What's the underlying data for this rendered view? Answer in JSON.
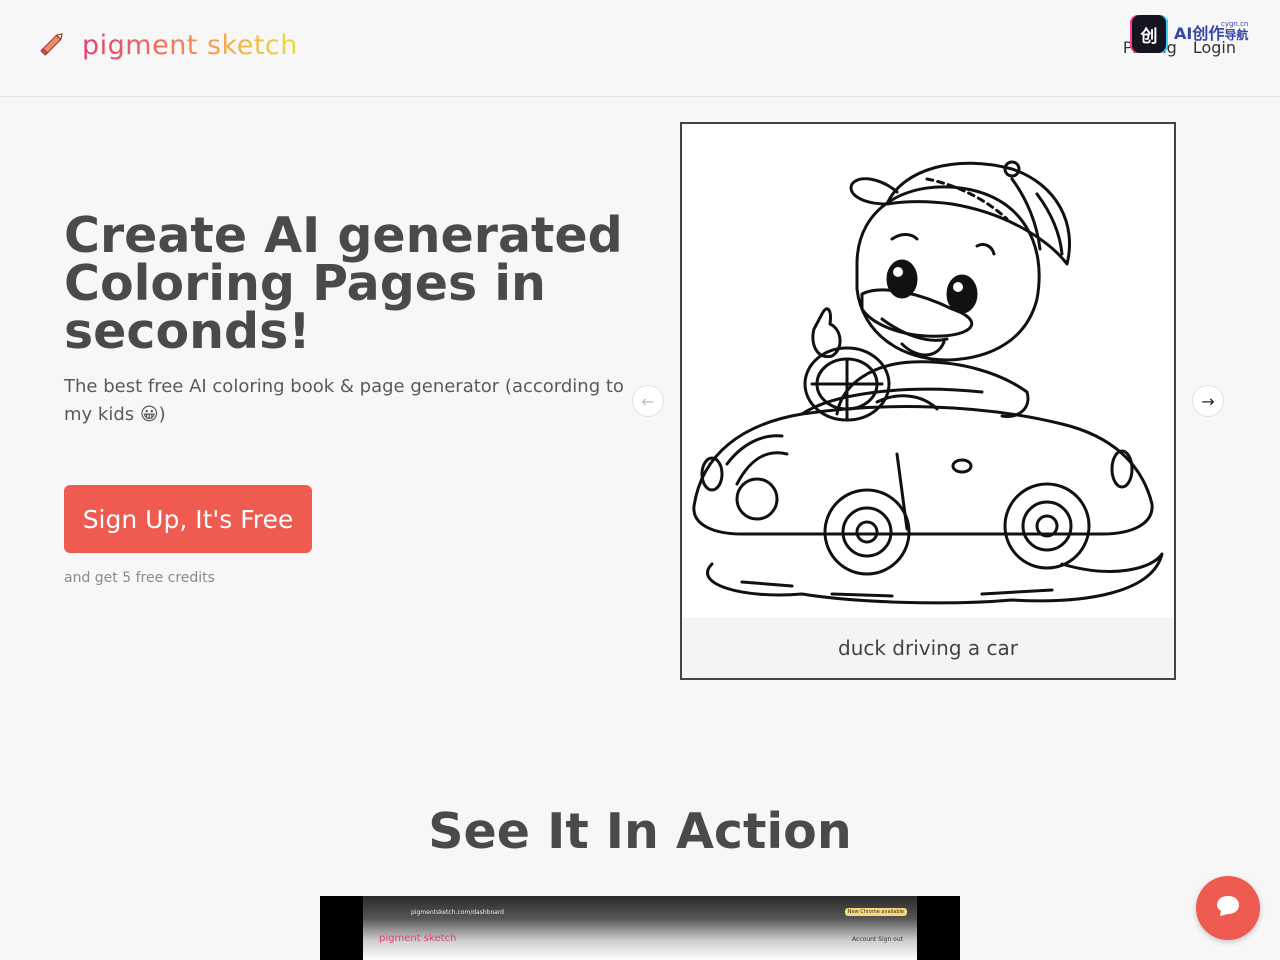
{
  "header": {
    "logo_text": "pigment sketch",
    "nav": [
      {
        "label": "Pricing"
      },
      {
        "label": "Login"
      }
    ],
    "badge": {
      "mark": "创",
      "text": "AI创作",
      "sub": "导航",
      "domain": "cygn.cn"
    }
  },
  "hero": {
    "title": "Create AI generated Coloring Pages in seconds!",
    "subtitle": "The best free AI coloring book & page generator (according to my kids 😀)",
    "cta_label": "Sign Up, It's Free",
    "credits_note": "and get 5 free credits"
  },
  "carousel": {
    "caption": "duck driving a car",
    "prev_icon": "arrow-left-icon",
    "next_icon": "arrow-right-icon"
  },
  "action_section": {
    "title": "See It In Action",
    "video": {
      "url": "pigmentsketch.com/dashboard",
      "logo": "pigment sketch",
      "links": "Account   Sign out",
      "chip": "New Chrome available"
    }
  },
  "colors": {
    "accent": "#ef5b50",
    "text": "#4a4a4a",
    "background": "#f7f7f7"
  }
}
